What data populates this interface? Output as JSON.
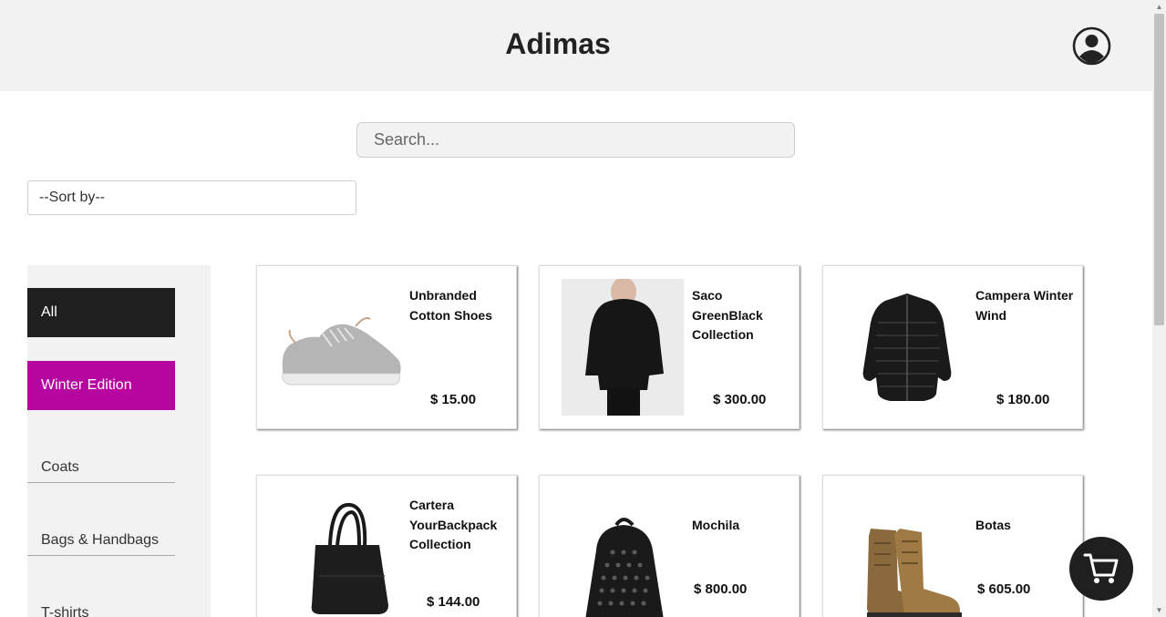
{
  "header": {
    "brand": "Adimas",
    "account_icon": "user-circle-icon"
  },
  "search": {
    "placeholder": "Search..."
  },
  "sort": {
    "selected": "--Sort by--"
  },
  "categories": [
    {
      "label": "All",
      "state": "selected"
    },
    {
      "label": "Winter Edition",
      "state": "highlighted"
    },
    {
      "label": "Coats"
    },
    {
      "label": "Bags & Handbags"
    },
    {
      "label": "T-shirts"
    }
  ],
  "products": [
    {
      "name": "Unbranded Cotton Shoes",
      "price": "$ 15.00",
      "image": "gray-sneaker-image"
    },
    {
      "name": "Saco GreenBlack Collection",
      "price": "$ 300.00",
      "image": "black-sweater-image"
    },
    {
      "name": "Campera Winter Wind",
      "price": "$ 180.00",
      "image": "black-puffer-jacket-image"
    },
    {
      "name": "Cartera YourBackpack Collection",
      "price": "$ 144.00",
      "image": "black-handbag-image"
    },
    {
      "name": "Mochila",
      "price": "$ 800.00",
      "image": "black-studded-backpack-image"
    },
    {
      "name": "Botas",
      "price": "$ 605.00",
      "image": "brown-boots-image"
    }
  ],
  "cart": {
    "icon": "shopping-cart-icon"
  },
  "colors": {
    "header_bg": "#f2f2f2",
    "active_category": "#1f1f1f",
    "winter_category": "#b5069f",
    "cart_bg": "#1f1f1f"
  }
}
